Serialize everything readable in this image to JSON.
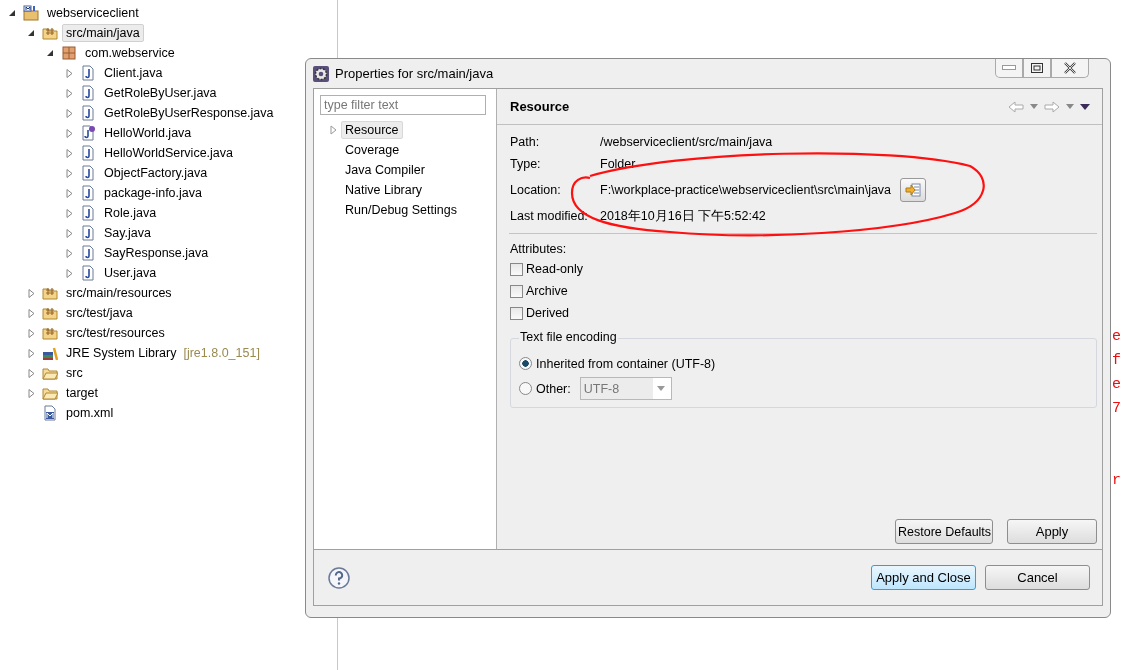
{
  "project_tree": {
    "items": [
      {
        "label": "webserviceclient",
        "kind": "project",
        "expanded": true,
        "selected": false,
        "children": [
          {
            "label": "src/main/java",
            "kind": "sourcefolder",
            "expanded": true,
            "selected": true,
            "children": [
              {
                "label": "com.webservice",
                "kind": "package",
                "expanded": true,
                "selected": false,
                "children": [
                  {
                    "label": "Client.java",
                    "kind": "class",
                    "expanded": false,
                    "selected": false
                  },
                  {
                    "label": "GetRoleByUser.java",
                    "kind": "class",
                    "expanded": false,
                    "selected": false
                  },
                  {
                    "label": "GetRoleByUserResponse.java",
                    "kind": "class",
                    "expanded": false,
                    "selected": false
                  },
                  {
                    "label": "HelloWorld.java",
                    "kind": "interface",
                    "expanded": false,
                    "selected": false
                  },
                  {
                    "label": "HelloWorldService.java",
                    "kind": "class",
                    "expanded": false,
                    "selected": false
                  },
                  {
                    "label": "ObjectFactory.java",
                    "kind": "class",
                    "expanded": false,
                    "selected": false
                  },
                  {
                    "label": "package-info.java",
                    "kind": "class",
                    "expanded": false,
                    "selected": false
                  },
                  {
                    "label": "Role.java",
                    "kind": "class",
                    "expanded": false,
                    "selected": false
                  },
                  {
                    "label": "Say.java",
                    "kind": "class",
                    "expanded": false,
                    "selected": false
                  },
                  {
                    "label": "SayResponse.java",
                    "kind": "class",
                    "expanded": false,
                    "selected": false
                  },
                  {
                    "label": "User.java",
                    "kind": "class",
                    "expanded": false,
                    "selected": false
                  }
                ]
              }
            ]
          },
          {
            "label": "src/main/resources",
            "kind": "sourcefolder",
            "expanded": false,
            "selected": false
          },
          {
            "label": "src/test/java",
            "kind": "sourcefolder",
            "expanded": false,
            "selected": false
          },
          {
            "label": "src/test/resources",
            "kind": "sourcefolder",
            "expanded": false,
            "selected": false
          },
          {
            "label": "JRE System Library",
            "decoration": "[jre1.8.0_151]",
            "kind": "library",
            "expanded": false,
            "selected": false
          },
          {
            "label": "src",
            "kind": "folder",
            "expanded": false,
            "selected": false
          },
          {
            "label": "target",
            "kind": "folder",
            "expanded": false,
            "selected": false
          },
          {
            "label": "pom.xml",
            "kind": "pom",
            "selected": false
          }
        ]
      }
    ]
  },
  "background_editor": {
    "fragments": [
      "e",
      "f",
      "e",
      "7",
      "r"
    ]
  },
  "dialog": {
    "title": "Properties for src/main/java",
    "filter": {
      "placeholder": "type filter text"
    },
    "nav": [
      {
        "label": "Resource",
        "expandable": true,
        "selected": true
      },
      {
        "label": "Coverage",
        "expandable": false,
        "selected": false
      },
      {
        "label": "Java Compiler",
        "expandable": false,
        "selected": false
      },
      {
        "label": "Native Library",
        "expandable": false,
        "selected": false
      },
      {
        "label": "Run/Debug Settings",
        "expandable": false,
        "selected": false
      }
    ],
    "page": {
      "title": "Resource",
      "fields": [
        {
          "label": "Path:",
          "value": "/webserviceclient/src/main/java",
          "kind": "text"
        },
        {
          "label": "Type:",
          "value": "Folder",
          "kind": "text"
        },
        {
          "label": "Location:",
          "value": "F:\\workplace-practice\\webserviceclient\\src\\main\\java",
          "kind": "location"
        },
        {
          "label": "Last modified:",
          "value": "2018年10月16日 下午5:52:42",
          "kind": "text"
        }
      ],
      "attributes_label": "Attributes:",
      "attributes": [
        {
          "label": "Read-only",
          "checked": false
        },
        {
          "label": "Archive",
          "checked": false
        },
        {
          "label": "Derived",
          "checked": false
        }
      ],
      "encoding": {
        "title": "Text file encoding",
        "options": [
          {
            "label": "Inherited from container (UTF-8)",
            "selected": true
          },
          {
            "label": "Other:",
            "selected": false,
            "dropdown": "UTF-8"
          }
        ]
      },
      "buttons": [
        "Restore Defaults",
        "Apply"
      ]
    },
    "footer_buttons": [
      {
        "label": "Apply and Close",
        "default": true
      },
      {
        "label": "Cancel",
        "default": false
      }
    ]
  }
}
